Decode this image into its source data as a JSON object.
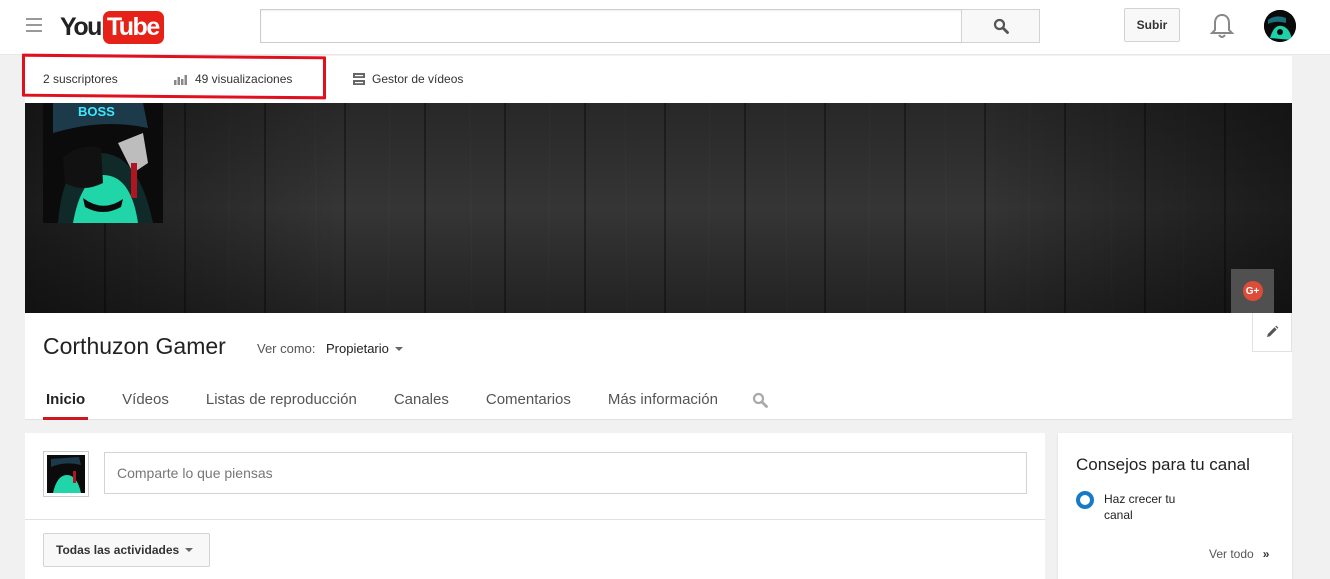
{
  "masthead": {
    "logo_you": "You",
    "logo_tube": "Tube",
    "search_placeholder": "",
    "upload_label": "Subir"
  },
  "stats": {
    "subscribers": "2 suscriptores",
    "views": "49 visualizaciones",
    "video_manager": "Gestor de vídeos"
  },
  "channel": {
    "title": "Corthuzon Gamer",
    "view_as_label": "Ver como:",
    "view_as_value": "Propietario",
    "gplus_label": "G+"
  },
  "tabs": [
    {
      "label": "Inicio",
      "active": true
    },
    {
      "label": "Vídeos"
    },
    {
      "label": "Listas de reproducción"
    },
    {
      "label": "Canales"
    },
    {
      "label": "Comentarios"
    },
    {
      "label": "Más información"
    }
  ],
  "feed": {
    "share_placeholder": "Comparte lo que piensas",
    "activities_filter": "Todas las actividades"
  },
  "tips": {
    "title": "Consejos para tu canal",
    "item": "Haz crecer tu canal",
    "see_all": "Ver todo",
    "see_all_chevron": "»"
  },
  "colors": {
    "brand_red": "#e62117",
    "tab_underline": "#cc181e",
    "highlight": "#e0101f",
    "tip_ring": "#167ac6",
    "gplus": "#dd4b39"
  }
}
